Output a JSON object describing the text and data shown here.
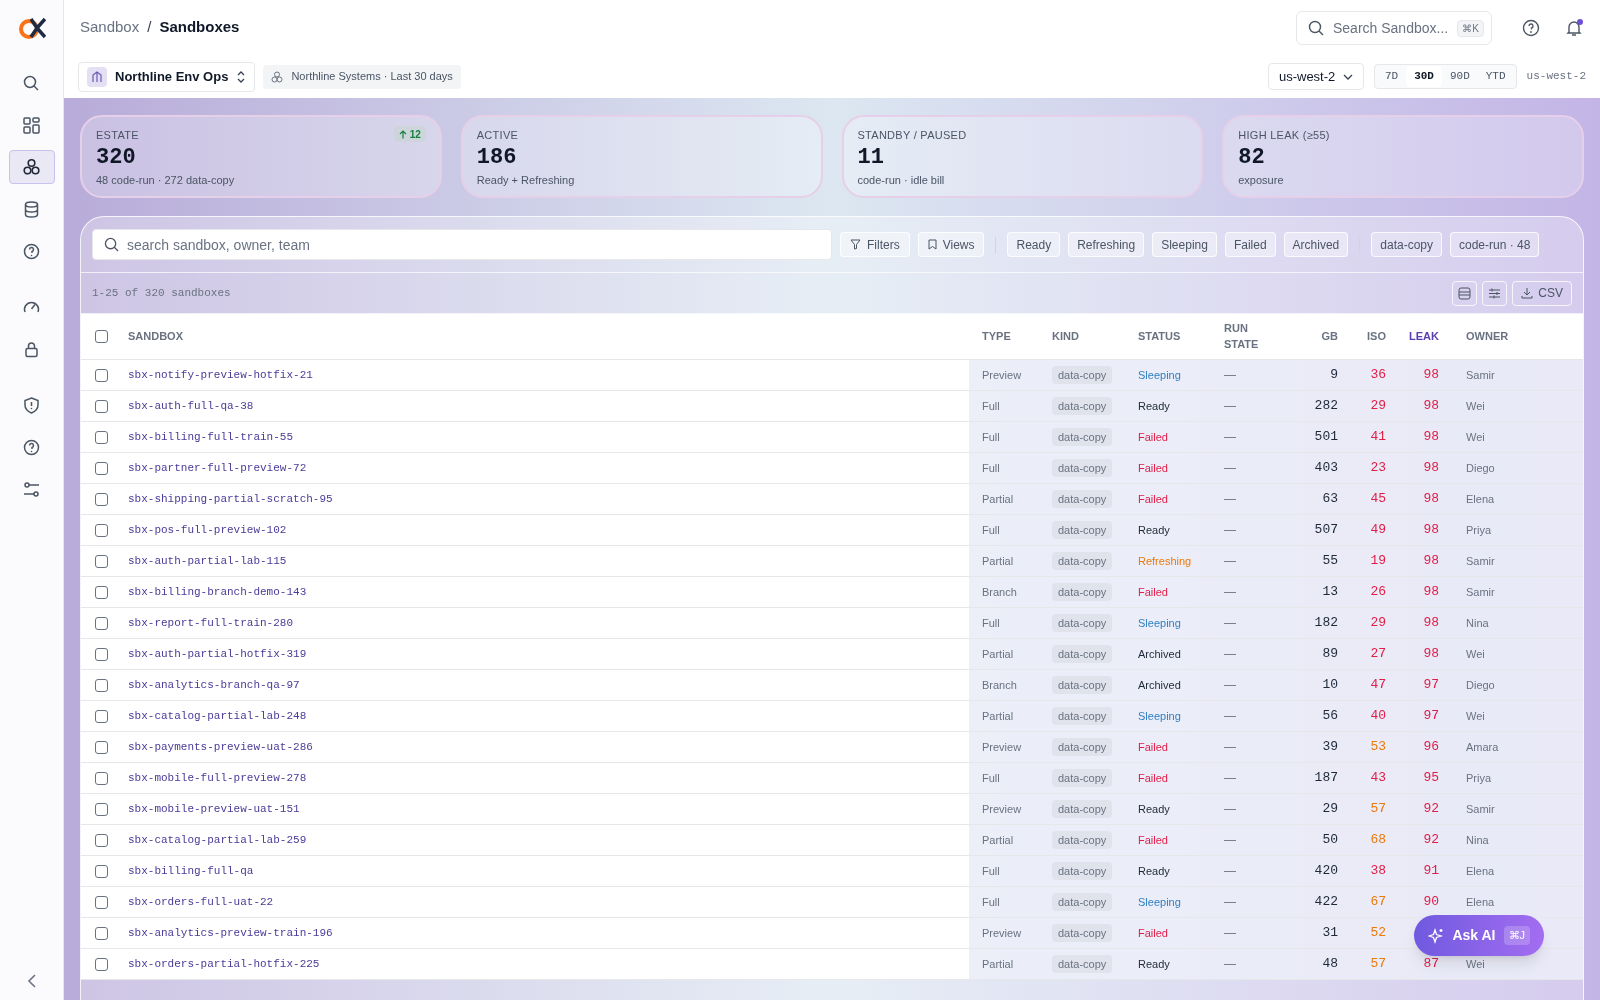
{
  "sidebar": {
    "items": [
      {
        "selected": false
      },
      {
        "selected": false
      },
      {
        "selected": true
      },
      {
        "selected": false
      },
      {
        "selected": false
      },
      {
        "selected": false
      },
      {
        "selected": false
      },
      {
        "selected": false
      },
      {
        "selected": false
      },
      {
        "selected": false
      }
    ]
  },
  "breadcrumb": [
    "Sandbox",
    "/",
    "Sandboxes"
  ],
  "global_search": {
    "placeholder": "Search Sandbox...",
    "shortcut": "⌘K"
  },
  "workspace": {
    "name": "Northline Env Ops",
    "context": "Northline Systems · Last 30 days"
  },
  "region_select": {
    "value": "us-west-2"
  },
  "ranges": [
    {
      "label": "7D",
      "selected": false
    },
    {
      "label": "30D",
      "selected": true
    },
    {
      "label": "90D",
      "selected": false
    },
    {
      "label": "YTD",
      "selected": false
    }
  ],
  "region_label": "us-west-2",
  "stats": [
    {
      "label": "ESTATE",
      "value": "320",
      "sub": "48 code-run · 272 data-copy",
      "delta": "12"
    },
    {
      "label": "ACTIVE",
      "value": "186",
      "sub": "Ready + Refreshing"
    },
    {
      "label": "STANDBY / PAUSED",
      "value": "11",
      "sub": "code-run · idle bill"
    },
    {
      "label": "HIGH LEAK (≥55)",
      "value": "82",
      "sub": "exposure"
    }
  ],
  "table_search": {
    "placeholder": "search sandbox, owner, team"
  },
  "toolbar_buttons": [
    {
      "kind": "filter",
      "label": "Filters"
    },
    {
      "kind": "bookmark",
      "label": "Views"
    }
  ],
  "status_chips": [
    "Ready",
    "Refreshing",
    "Sleeping",
    "Failed",
    "Archived"
  ],
  "kind_chips": [
    "data-copy",
    "code-run · 48"
  ],
  "count": "1-25 of 320 sandboxes",
  "select_all": {
    "checked": false
  },
  "export": {
    "label": "CSV"
  },
  "columns": [
    {
      "label": "SANDBOX",
      "sorted": false
    },
    {
      "label": "TYPE",
      "sorted": false
    },
    {
      "label": "KIND",
      "sorted": false
    },
    {
      "label": "STATUS",
      "sorted": false
    },
    {
      "label": "RUN STATE",
      "sorted": false
    },
    {
      "label": "GB",
      "sorted": false
    },
    {
      "label": "ISO",
      "sorted": false
    },
    {
      "label": "LEAK",
      "sorted": true
    },
    {
      "label": "OWNER",
      "sorted": false
    }
  ],
  "rows": [
    {
      "checked": false,
      "name": "sbx-notify-preview-hotfix-21",
      "type": "Preview",
      "kind": "data-copy",
      "status": {
        "text": "Sleeping",
        "color": "#2f7fc1"
      },
      "run_state": "—",
      "gb": "9",
      "iso": {
        "text": "36",
        "color": "#e11d48"
      },
      "leak": "98",
      "owner": "Samir"
    },
    {
      "checked": false,
      "name": "sbx-auth-full-qa-38",
      "type": "Full",
      "kind": "data-copy",
      "status": {
        "text": "Ready",
        "color": "#1f2937"
      },
      "run_state": "—",
      "gb": "282",
      "iso": {
        "text": "29",
        "color": "#e11d48"
      },
      "leak": "98",
      "owner": "Wei"
    },
    {
      "checked": false,
      "name": "sbx-billing-full-train-55",
      "type": "Full",
      "kind": "data-copy",
      "status": {
        "text": "Failed",
        "color": "#e11d48"
      },
      "run_state": "—",
      "gb": "501",
      "iso": {
        "text": "41",
        "color": "#e11d48"
      },
      "leak": "98",
      "owner": "Wei"
    },
    {
      "checked": false,
      "name": "sbx-partner-full-preview-72",
      "type": "Full",
      "kind": "data-copy",
      "status": {
        "text": "Failed",
        "color": "#e11d48"
      },
      "run_state": "—",
      "gb": "403",
      "iso": {
        "text": "23",
        "color": "#e11d48"
      },
      "leak": "98",
      "owner": "Diego"
    },
    {
      "checked": false,
      "name": "sbx-shipping-partial-scratch-95",
      "type": "Partial",
      "kind": "data-copy",
      "status": {
        "text": "Failed",
        "color": "#e11d48"
      },
      "run_state": "—",
      "gb": "63",
      "iso": {
        "text": "45",
        "color": "#e11d48"
      },
      "leak": "98",
      "owner": "Elena"
    },
    {
      "checked": false,
      "name": "sbx-pos-full-preview-102",
      "type": "Full",
      "kind": "data-copy",
      "status": {
        "text": "Ready",
        "color": "#1f2937"
      },
      "run_state": "—",
      "gb": "507",
      "iso": {
        "text": "49",
        "color": "#e11d48"
      },
      "leak": "98",
      "owner": "Priya"
    },
    {
      "checked": false,
      "name": "sbx-auth-partial-lab-115",
      "type": "Partial",
      "kind": "data-copy",
      "status": {
        "text": "Refreshing",
        "color": "#ea7a0c"
      },
      "run_state": "—",
      "gb": "55",
      "iso": {
        "text": "19",
        "color": "#e11d48"
      },
      "leak": "98",
      "owner": "Samir"
    },
    {
      "checked": false,
      "name": "sbx-billing-branch-demo-143",
      "type": "Branch",
      "kind": "data-copy",
      "status": {
        "text": "Failed",
        "color": "#e11d48"
      },
      "run_state": "—",
      "gb": "13",
      "iso": {
        "text": "26",
        "color": "#e11d48"
      },
      "leak": "98",
      "owner": "Samir"
    },
    {
      "checked": false,
      "name": "sbx-report-full-train-280",
      "type": "Full",
      "kind": "data-copy",
      "status": {
        "text": "Sleeping",
        "color": "#2f7fc1"
      },
      "run_state": "—",
      "gb": "182",
      "iso": {
        "text": "29",
        "color": "#e11d48"
      },
      "leak": "98",
      "owner": "Nina"
    },
    {
      "checked": false,
      "name": "sbx-auth-partial-hotfix-319",
      "type": "Partial",
      "kind": "data-copy",
      "status": {
        "text": "Archived",
        "color": "#1f2937"
      },
      "run_state": "—",
      "gb": "89",
      "iso": {
        "text": "27",
        "color": "#e11d48"
      },
      "leak": "98",
      "owner": "Wei"
    },
    {
      "checked": false,
      "name": "sbx-analytics-branch-qa-97",
      "type": "Branch",
      "kind": "data-copy",
      "status": {
        "text": "Archived",
        "color": "#1f2937"
      },
      "run_state": "—",
      "gb": "10",
      "iso": {
        "text": "47",
        "color": "#e11d48"
      },
      "leak": "97",
      "owner": "Diego"
    },
    {
      "checked": false,
      "name": "sbx-catalog-partial-lab-248",
      "type": "Partial",
      "kind": "data-copy",
      "status": {
        "text": "Sleeping",
        "color": "#2f7fc1"
      },
      "run_state": "—",
      "gb": "56",
      "iso": {
        "text": "40",
        "color": "#e11d48"
      },
      "leak": "97",
      "owner": "Wei"
    },
    {
      "checked": false,
      "name": "sbx-payments-preview-uat-286",
      "type": "Preview",
      "kind": "data-copy",
      "status": {
        "text": "Failed",
        "color": "#e11d48"
      },
      "run_state": "—",
      "gb": "39",
      "iso": {
        "text": "53",
        "color": "#ea7a0c"
      },
      "leak": "96",
      "owner": "Amara"
    },
    {
      "checked": false,
      "name": "sbx-mobile-full-preview-278",
      "type": "Full",
      "kind": "data-copy",
      "status": {
        "text": "Failed",
        "color": "#e11d48"
      },
      "run_state": "—",
      "gb": "187",
      "iso": {
        "text": "43",
        "color": "#e11d48"
      },
      "leak": "95",
      "owner": "Priya"
    },
    {
      "checked": false,
      "name": "sbx-mobile-preview-uat-151",
      "type": "Preview",
      "kind": "data-copy",
      "status": {
        "text": "Ready",
        "color": "#1f2937"
      },
      "run_state": "—",
      "gb": "29",
      "iso": {
        "text": "57",
        "color": "#ea7a0c"
      },
      "leak": "92",
      "owner": "Samir"
    },
    {
      "checked": false,
      "name": "sbx-catalog-partial-lab-259",
      "type": "Partial",
      "kind": "data-copy",
      "status": {
        "text": "Failed",
        "color": "#e11d48"
      },
      "run_state": "—",
      "gb": "50",
      "iso": {
        "text": "68",
        "color": "#ea7a0c"
      },
      "leak": "92",
      "owner": "Nina"
    },
    {
      "checked": false,
      "name": "sbx-billing-full-qa",
      "type": "Full",
      "kind": "data-copy",
      "status": {
        "text": "Ready",
        "color": "#1f2937"
      },
      "run_state": "—",
      "gb": "420",
      "iso": {
        "text": "38",
        "color": "#e11d48"
      },
      "leak": "91",
      "owner": "Elena"
    },
    {
      "checked": false,
      "name": "sbx-orders-full-uat-22",
      "type": "Full",
      "kind": "data-copy",
      "status": {
        "text": "Sleeping",
        "color": "#2f7fc1"
      },
      "run_state": "—",
      "gb": "422",
      "iso": {
        "text": "67",
        "color": "#ea7a0c"
      },
      "leak": "90",
      "owner": "Elena"
    },
    {
      "checked": false,
      "name": "sbx-analytics-preview-train-196",
      "type": "Preview",
      "kind": "data-copy",
      "status": {
        "text": "Failed",
        "color": "#e11d48"
      },
      "run_state": "—",
      "gb": "31",
      "iso": {
        "text": "52",
        "color": "#ea7a0c"
      }
    },
    {
      "checked": false,
      "name": "sbx-orders-partial-hotfix-225",
      "type": "Partial",
      "kind": "data-copy",
      "status": {
        "text": "Ready",
        "color": "#1f2937"
      },
      "run_state": "—",
      "gb": "48",
      "iso": {
        "text": "57",
        "color": "#ea7a0c"
      },
      "leak": "87",
      "owner": "Wei"
    }
  ],
  "ask_ai": {
    "label": "Ask AI",
    "shortcut": "⌘J"
  }
}
